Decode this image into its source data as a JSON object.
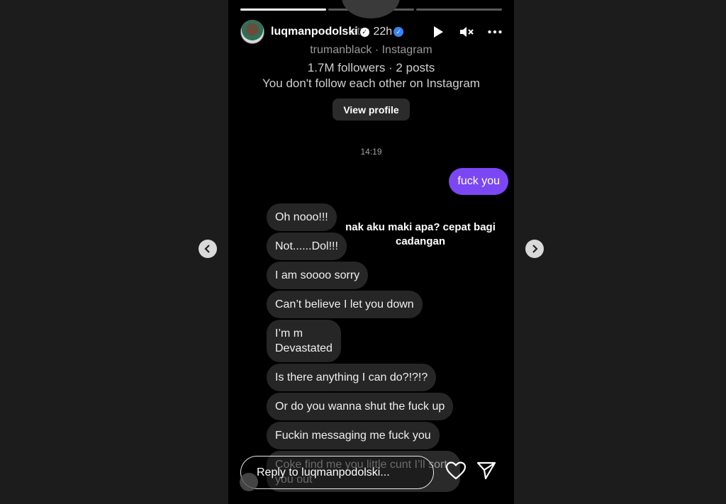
{
  "story": {
    "progress": [
      1.0,
      0.0,
      0.0
    ]
  },
  "header": {
    "username": "luqmanpodolski",
    "time_ago": "22h",
    "ghost_text": "atty"
  },
  "profile": {
    "subtitle": "trumanblack · Instagram",
    "stats": "1.7M followers · 2 posts",
    "follow_note": "You don't follow each other on Instagram",
    "view_profile_label": "View profile"
  },
  "chat": {
    "timestamp": "14:19",
    "sent_message": "fuck you",
    "received": [
      "Oh nooo!!!",
      "Not......Dol!!!",
      "I am soooo sorry",
      "Can’t believe I let you down",
      "I’m m\nDevastated",
      "Is there anything I can do?!?!?",
      "Or do you wanna shut the fuck up",
      "Fuckin messaging me fuck you",
      "Coke find me you little cunt I’ll sort you out"
    ]
  },
  "caption": "nak aku maki apa? cepat bagi cadangan",
  "reply": {
    "placeholder": "Reply to luqmanpodolski..."
  },
  "icons": {
    "play": "play-icon",
    "mute": "mute-icon",
    "more": "more-icon",
    "heart": "heart-icon",
    "send": "send-icon",
    "prev": "chevron-left-icon",
    "next": "chevron-right-icon"
  },
  "colors": {
    "sent_bubble": "#7b47f5",
    "received_bubble": "#262626",
    "background": "#000000",
    "page_bg": "#1c1c1c"
  }
}
